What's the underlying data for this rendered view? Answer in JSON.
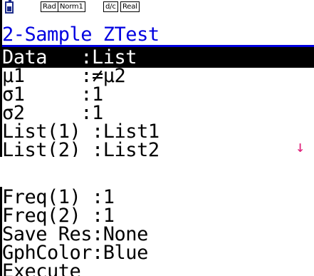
{
  "status_bar": {
    "badge1": "Rad",
    "badge2": "Norm1",
    "badge3": "d/c",
    "badge4": "Real"
  },
  "title": "2-Sample ZTest",
  "screen1_rows": [
    "Data   :List",
    "μ1     :≠μ2",
    "σ1     :1",
    "σ2     :1",
    "List(1) :List1",
    "List(2) :List2"
  ],
  "screen2_rows": [
    "Freq(1) :1",
    "Freq(2) :1",
    "Save Res:None",
    "GphColor:Blue",
    "Execute"
  ],
  "colors": {
    "title": "#0000e0",
    "scroll_arrow": "#e0207a",
    "battery": "#1a2a8a"
  },
  "icons": {
    "battery": "battery-icon",
    "scroll": "down-arrow-icon"
  },
  "scroll_arrow": "↓"
}
